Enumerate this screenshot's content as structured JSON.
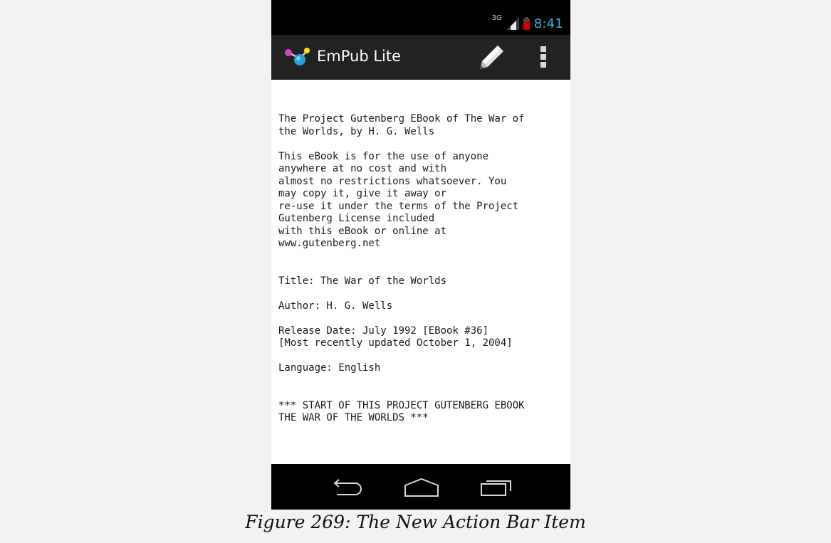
{
  "status_bar": {
    "network_label": "3G",
    "time": "8:41",
    "icons": [
      "signal-icon",
      "battery-low-icon"
    ],
    "colors": {
      "time": "#33b5e5",
      "battery": "#cc0000"
    }
  },
  "action_bar": {
    "title": "EmPub Lite",
    "icons": [
      "app-logo-icon",
      "pencil-icon",
      "overflow-menu-icon"
    ]
  },
  "content": {
    "lines": [
      "The Project Gutenberg EBook of The War of",
      "the Worlds, by H. G. Wells",
      "",
      "This eBook is for the use of anyone",
      "anywhere at no cost and with",
      "almost no restrictions whatsoever. You",
      "may copy it, give it away or",
      "re-use it under the terms of the Project",
      "Gutenberg License included",
      "with this eBook or online at",
      "www.gutenberg.net",
      "",
      "",
      "Title: The War of the Worlds",
      "",
      "Author: H. G. Wells",
      "",
      "Release Date: July 1992 [EBook #36]",
      "[Most recently updated October 1, 2004]",
      "",
      "Language: English",
      "",
      "",
      "*** START OF THIS PROJECT GUTENBERG EBOOK",
      "THE WAR OF THE WORLDS ***"
    ]
  },
  "nav_bar": {
    "icons": [
      "back-icon",
      "home-icon",
      "recent-apps-icon"
    ]
  },
  "caption": "Figure 269: The New Action Bar Item"
}
